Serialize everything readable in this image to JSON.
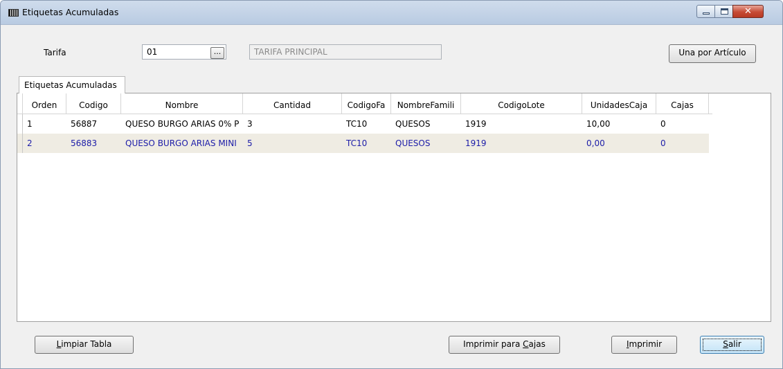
{
  "window": {
    "title": "Etiquetas Acumuladas",
    "colors": {
      "title_bar": "#c4d4e8",
      "close_button": "#c64a34"
    }
  },
  "form": {
    "tarifa_label": "Tarifa",
    "tarifa_value": "01",
    "lookup_label": "...",
    "tarifa_name": "TARIFA PRINCIPAL",
    "una_por_articulo_label": "Una por Artículo"
  },
  "tab": {
    "label": "Etiquetas Acumuladas"
  },
  "table": {
    "columns": [
      "Orden",
      "Codigo",
      "Nombre",
      "Cantidad",
      "CodigoFa",
      "NombreFamili",
      "CodigoLote",
      "UnidadesCaja",
      "Cajas"
    ],
    "rows": [
      {
        "orden": "1",
        "codigo": "56887",
        "nombre": "QUESO BURGO ARIAS 0% P",
        "cantidad": "3",
        "codigofa": "TC10",
        "nombrefamili": "QUESOS",
        "codigolote": "1919",
        "unidadescaja": "10,00",
        "cajas": "0"
      },
      {
        "orden": "2",
        "codigo": "56883",
        "nombre": "QUESO BURGO ARIAS MINI",
        "cantidad": "5",
        "codigofa": "TC10",
        "nombrefamili": "QUESOS",
        "codigolote": "1919",
        "unidadescaja": "0,00",
        "cajas": "0"
      }
    ],
    "colors": {
      "alt_row_bg": "#efece3",
      "alt_row_text": "#1c1ca8"
    }
  },
  "buttons": {
    "limpiar_prefix": "L",
    "limpiar_rest": "impiar Tabla",
    "imprimir_cajas_prefix": "Imprimir para ",
    "imprimir_cajas_key": "C",
    "imprimir_cajas_rest": "ajas",
    "imprimir_key": "I",
    "imprimir_rest": "mprimir",
    "salir_key": "S",
    "salir_rest": "alir"
  }
}
